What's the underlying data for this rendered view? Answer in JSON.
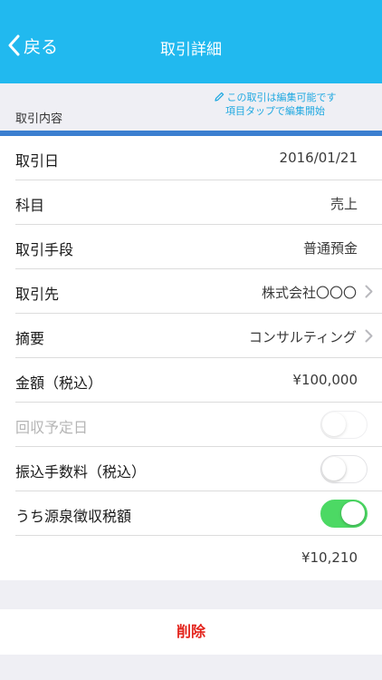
{
  "nav": {
    "back_label": "戻る",
    "title": "取引詳細"
  },
  "section": {
    "label": "取引内容",
    "edit_hint_line1": "この取引は編集可能です",
    "edit_hint_line2": "項目タップで編集開始"
  },
  "rows": [
    {
      "label": "取引日",
      "value": "2016/01/21"
    },
    {
      "label": "科目",
      "value": "売上"
    },
    {
      "label": "取引手段",
      "value": "普通預金"
    },
    {
      "label": "取引先",
      "value": "株式会社〇〇〇"
    },
    {
      "label": "摘要",
      "value": "コンサルティング"
    },
    {
      "label": "金額（税込）",
      "value": "¥100,000"
    },
    {
      "label": "回収予定日",
      "toggle": false,
      "disabled": true
    },
    {
      "label": "振込手数料（税込）",
      "toggle": false
    },
    {
      "label": "うち源泉徴収税額",
      "toggle": true
    },
    {
      "label": "",
      "value": "¥10,210"
    }
  ],
  "delete_label": "削除",
  "colors": {
    "navbar": "#21b9ef",
    "accent_line": "#3b7fd0",
    "toggle_on": "#4cd964",
    "delete": "#e3231b",
    "hint": "#21a9e1"
  }
}
